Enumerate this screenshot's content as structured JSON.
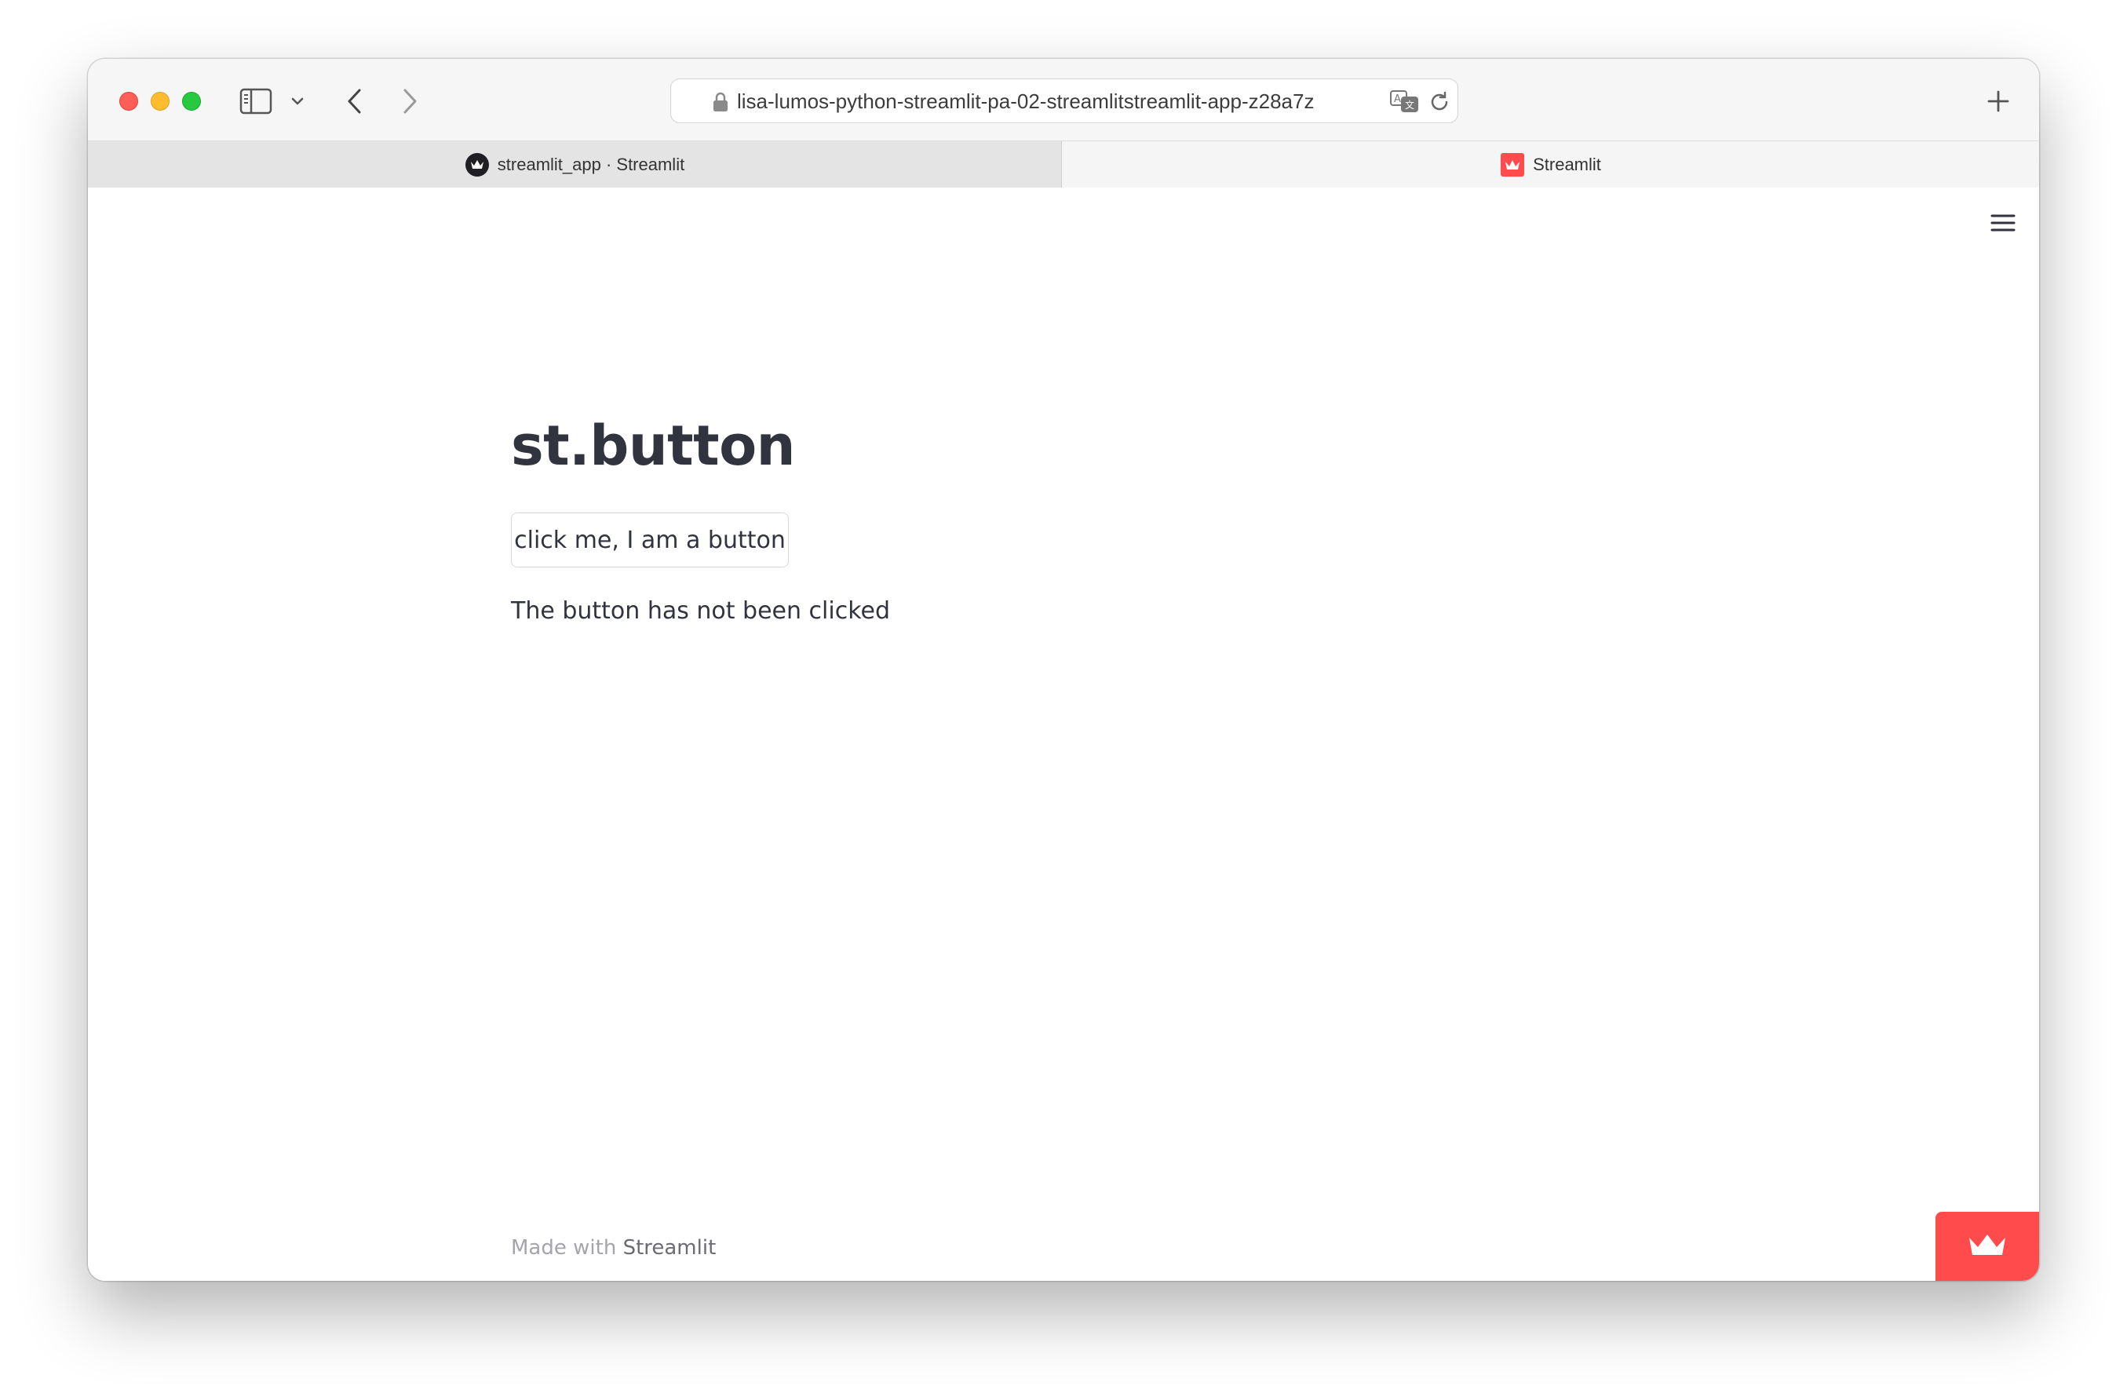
{
  "browser": {
    "url": "lisa-lumos-python-streamlit-pa-02-streamlitstreamlit-app-z28a7z",
    "tabs": [
      {
        "label": "streamlit_app · Streamlit",
        "icon": "streamlit-crown-dark-icon",
        "active": true
      },
      {
        "label": "Streamlit",
        "icon": "streamlit-crown-red-icon",
        "active": false
      }
    ]
  },
  "app": {
    "title": "st.button",
    "button_label": "click me, I am a button",
    "status": "The button has not been clicked",
    "footer_prefix": "Made with ",
    "footer_brand": "Streamlit"
  },
  "colors": {
    "accent": "#ff4b4b",
    "text": "#31333f",
    "decoration_gradient_start": "#ff4b4b",
    "decoration_gradient_end": "#fffd80"
  }
}
